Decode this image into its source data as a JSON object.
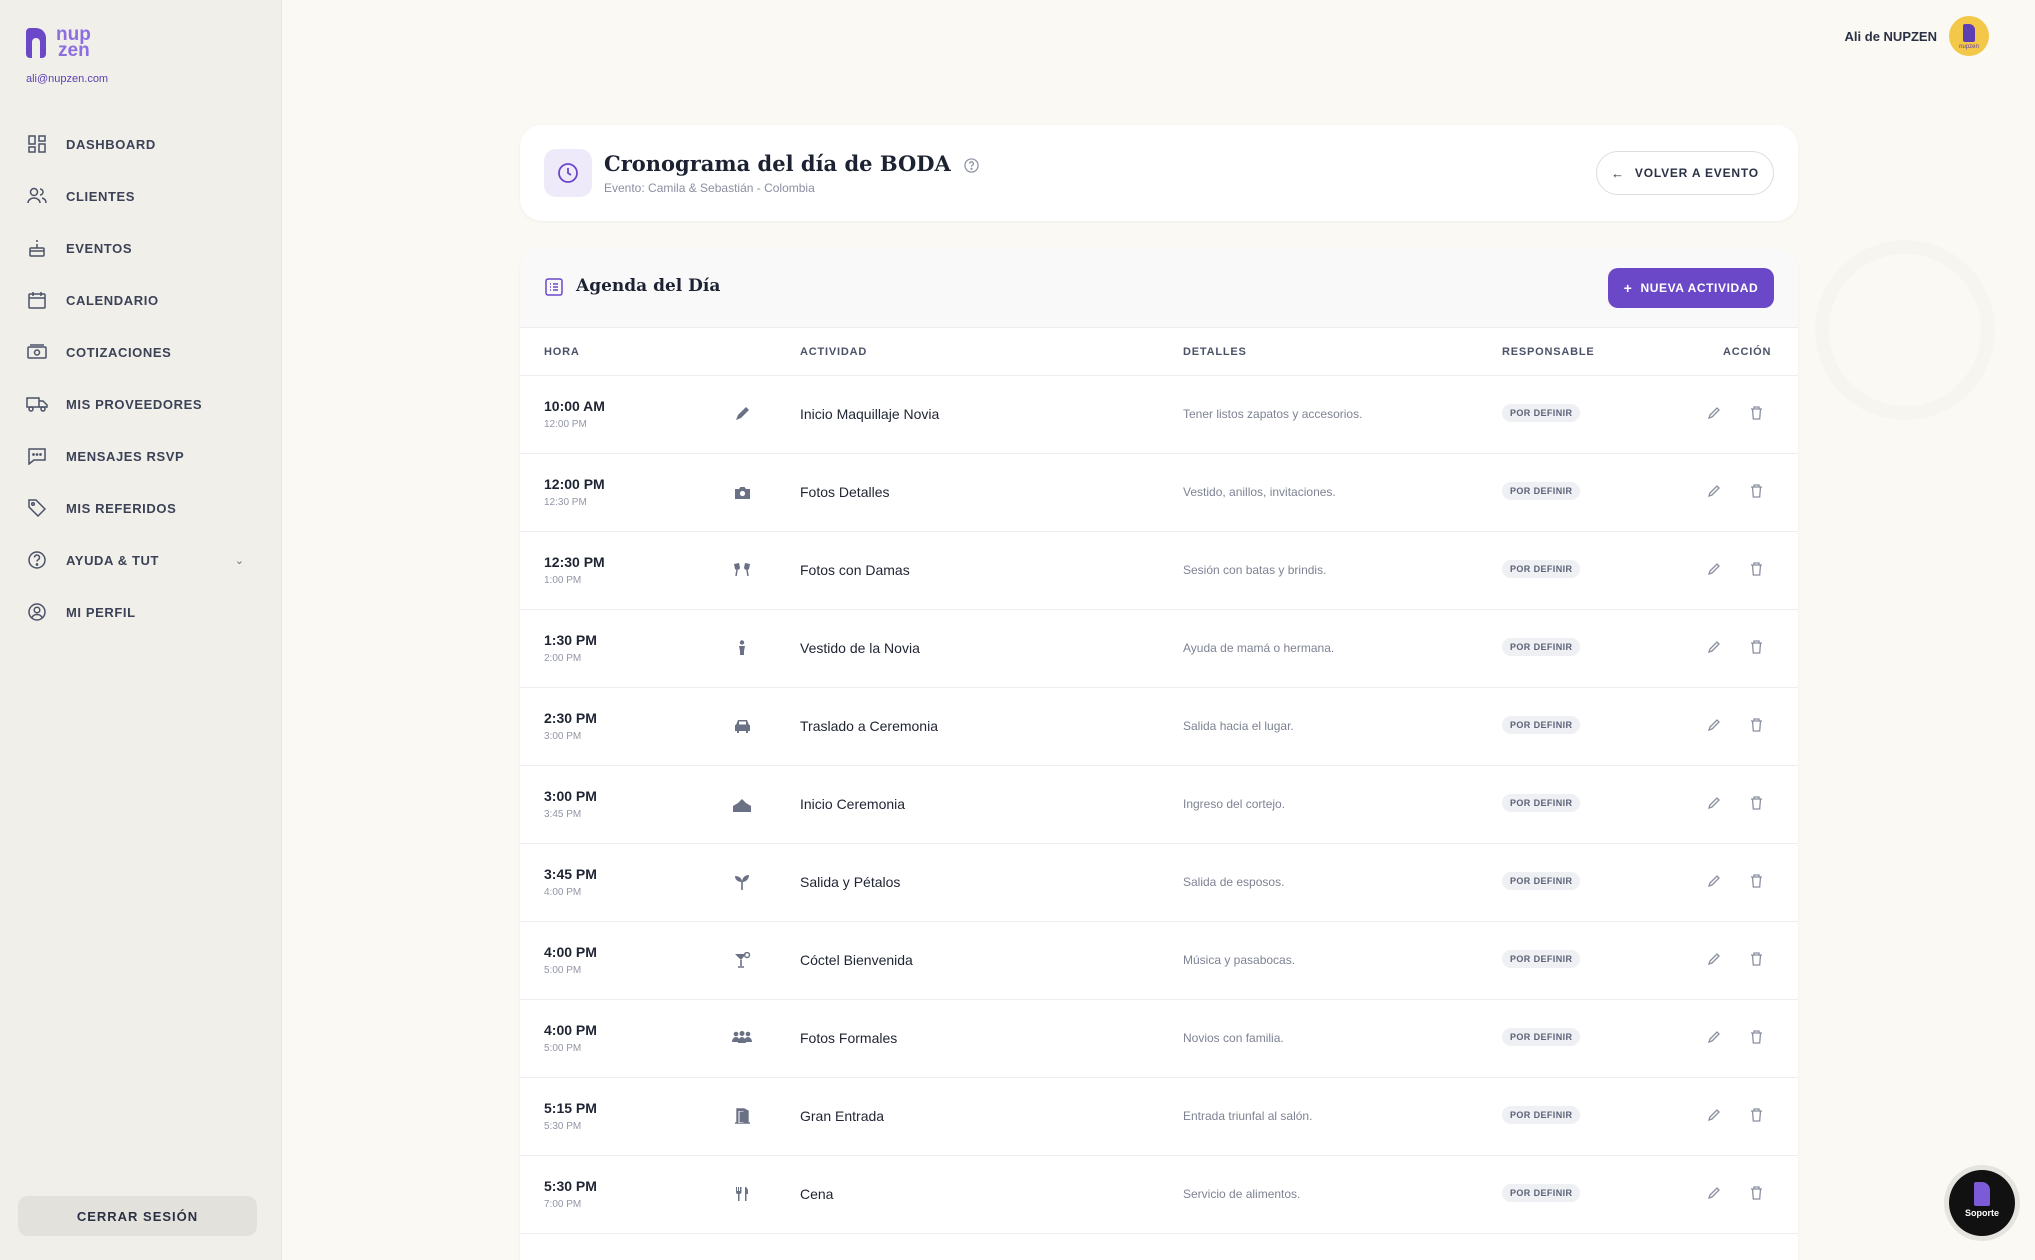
{
  "brand": {
    "logo_top": "nup",
    "logo_bottom": "zen",
    "email": "ali@nupzen.com"
  },
  "nav": [
    {
      "label": "DASHBOARD",
      "icon": "dashboard-icon"
    },
    {
      "label": "CLIENTES",
      "icon": "users-icon"
    },
    {
      "label": "EVENTOS",
      "icon": "cake-icon"
    },
    {
      "label": "CALENDARIO",
      "icon": "calendar-icon"
    },
    {
      "label": "COTIZACIONES",
      "icon": "money-icon"
    },
    {
      "label": "MIS PROVEEDORES",
      "icon": "truck-icon"
    },
    {
      "label": "MENSAJES RSVP",
      "icon": "message-icon"
    },
    {
      "label": "MIS REFERIDOS",
      "icon": "tag-icon"
    },
    {
      "label": "AYUDA & TUT",
      "icon": "help-icon"
    },
    {
      "label": "MI PERFIL",
      "icon": "profile-icon"
    }
  ],
  "logout_label": "CERRAR SESIÓN",
  "topbar": {
    "user_name": "Ali de NUPZEN",
    "avatar_text": "nupzen"
  },
  "header": {
    "title": "Cronograma del día de BODA",
    "subtitle": "Evento: Camila & Sebastián - Colombia",
    "back_label": "VOLVER A EVENTO"
  },
  "agenda": {
    "title": "Agenda del Día",
    "new_label": "NUEVA ACTIVIDAD",
    "columns": {
      "hora": "HORA",
      "actividad": "ACTIVIDAD",
      "detalles": "DETALLES",
      "responsable": "RESPONSABLE",
      "accion": "ACCIÓN"
    },
    "rows": [
      {
        "start": "10:00 AM",
        "end": "12:00 PM",
        "icon": "brush-icon",
        "activity": "Inicio Maquillaje Novia",
        "details": "Tener listos zapatos y accesorios.",
        "responsible": "POR DEFINIR"
      },
      {
        "start": "12:00 PM",
        "end": "12:30 PM",
        "icon": "camera-icon",
        "activity": "Fotos Detalles",
        "details": "Vestido, anillos, invitaciones.",
        "responsible": "POR DEFINIR"
      },
      {
        "start": "12:30 PM",
        "end": "1:00 PM",
        "icon": "cheers-icon",
        "activity": "Fotos con Damas",
        "details": "Sesión con batas y brindis.",
        "responsible": "POR DEFINIR"
      },
      {
        "start": "1:30 PM",
        "end": "2:00 PM",
        "icon": "person-icon",
        "activity": "Vestido de la Novia",
        "details": "Ayuda de mamá o hermana.",
        "responsible": "POR DEFINIR"
      },
      {
        "start": "2:30 PM",
        "end": "3:00 PM",
        "icon": "car-icon",
        "activity": "Traslado a Ceremonia",
        "details": "Salida hacia el lugar.",
        "responsible": "POR DEFINIR"
      },
      {
        "start": "3:00 PM",
        "end": "3:45 PM",
        "icon": "church-icon",
        "activity": "Inicio Ceremonia",
        "details": "Ingreso del cortejo.",
        "responsible": "POR DEFINIR"
      },
      {
        "start": "3:45 PM",
        "end": "4:00 PM",
        "icon": "sprout-icon",
        "activity": "Salida y Pétalos",
        "details": "Salida de esposos.",
        "responsible": "POR DEFINIR"
      },
      {
        "start": "4:00 PM",
        "end": "5:00 PM",
        "icon": "cocktail-icon",
        "activity": "Cóctel Bienvenida",
        "details": "Música y pasabocas.",
        "responsible": "POR DEFINIR"
      },
      {
        "start": "4:00 PM",
        "end": "5:00 PM",
        "icon": "group-icon",
        "activity": "Fotos Formales",
        "details": "Novios con familia.",
        "responsible": "POR DEFINIR"
      },
      {
        "start": "5:15 PM",
        "end": "5:30 PM",
        "icon": "door-icon",
        "activity": "Gran Entrada",
        "details": "Entrada triunfal al salón.",
        "responsible": "POR DEFINIR"
      },
      {
        "start": "5:30 PM",
        "end": "7:00 PM",
        "icon": "utensils-icon",
        "activity": "Cena",
        "details": "Servicio de alimentos.",
        "responsible": "POR DEFINIR"
      }
    ]
  },
  "support_label": "Soporte",
  "colors": {
    "accent": "#6b48c8",
    "sidebar_bg": "#f1efea",
    "page_bg": "#fbf9f4"
  }
}
